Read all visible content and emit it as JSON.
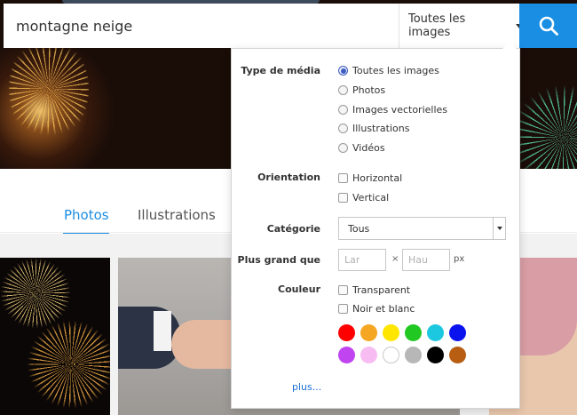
{
  "search": {
    "query": "montagne neige",
    "type_selected": "Toutes les images"
  },
  "tabs": [
    {
      "label": "Photos",
      "active": true
    },
    {
      "label": "Illustrations",
      "active": false
    }
  ],
  "filters": {
    "media_type": {
      "label": "Type de média",
      "options": [
        {
          "label": "Toutes les images",
          "checked": true
        },
        {
          "label": "Photos",
          "checked": false
        },
        {
          "label": "Images vectorielles",
          "checked": false
        },
        {
          "label": "Illustrations",
          "checked": false
        },
        {
          "label": "Vidéos",
          "checked": false
        }
      ]
    },
    "orientation": {
      "label": "Orientation",
      "options": [
        {
          "label": "Horizontal",
          "checked": false
        },
        {
          "label": "Vertical",
          "checked": false
        }
      ]
    },
    "category": {
      "label": "Catégorie",
      "value": "Tous"
    },
    "size": {
      "label": "Plus grand que",
      "width_placeholder": "Lar",
      "height_placeholder": "Hau",
      "separator": "×",
      "unit": "px"
    },
    "color": {
      "label": "Couleur",
      "options": [
        {
          "label": "Transparent",
          "checked": false
        },
        {
          "label": "Noir et blanc",
          "checked": false
        }
      ],
      "swatches": [
        {
          "name": "red",
          "hex": "#ff0000"
        },
        {
          "name": "orange",
          "hex": "#f5a623"
        },
        {
          "name": "yellow",
          "hex": "#ffe600"
        },
        {
          "name": "green",
          "hex": "#22c822"
        },
        {
          "name": "cyan",
          "hex": "#1cc8e0"
        },
        {
          "name": "blue",
          "hex": "#0a12ee"
        },
        {
          "name": "purple",
          "hex": "#c044f0"
        },
        {
          "name": "pink",
          "hex": "#f7bdf2"
        },
        {
          "name": "white",
          "hex": "#ffffff"
        },
        {
          "name": "gray",
          "hex": "#b7b7b7"
        },
        {
          "name": "black",
          "hex": "#000000"
        },
        {
          "name": "brown",
          "hex": "#b75e12"
        }
      ]
    },
    "more_link": "plus..."
  },
  "colors": {
    "accent": "#1a8ee2",
    "link": "#1a6fd6"
  }
}
